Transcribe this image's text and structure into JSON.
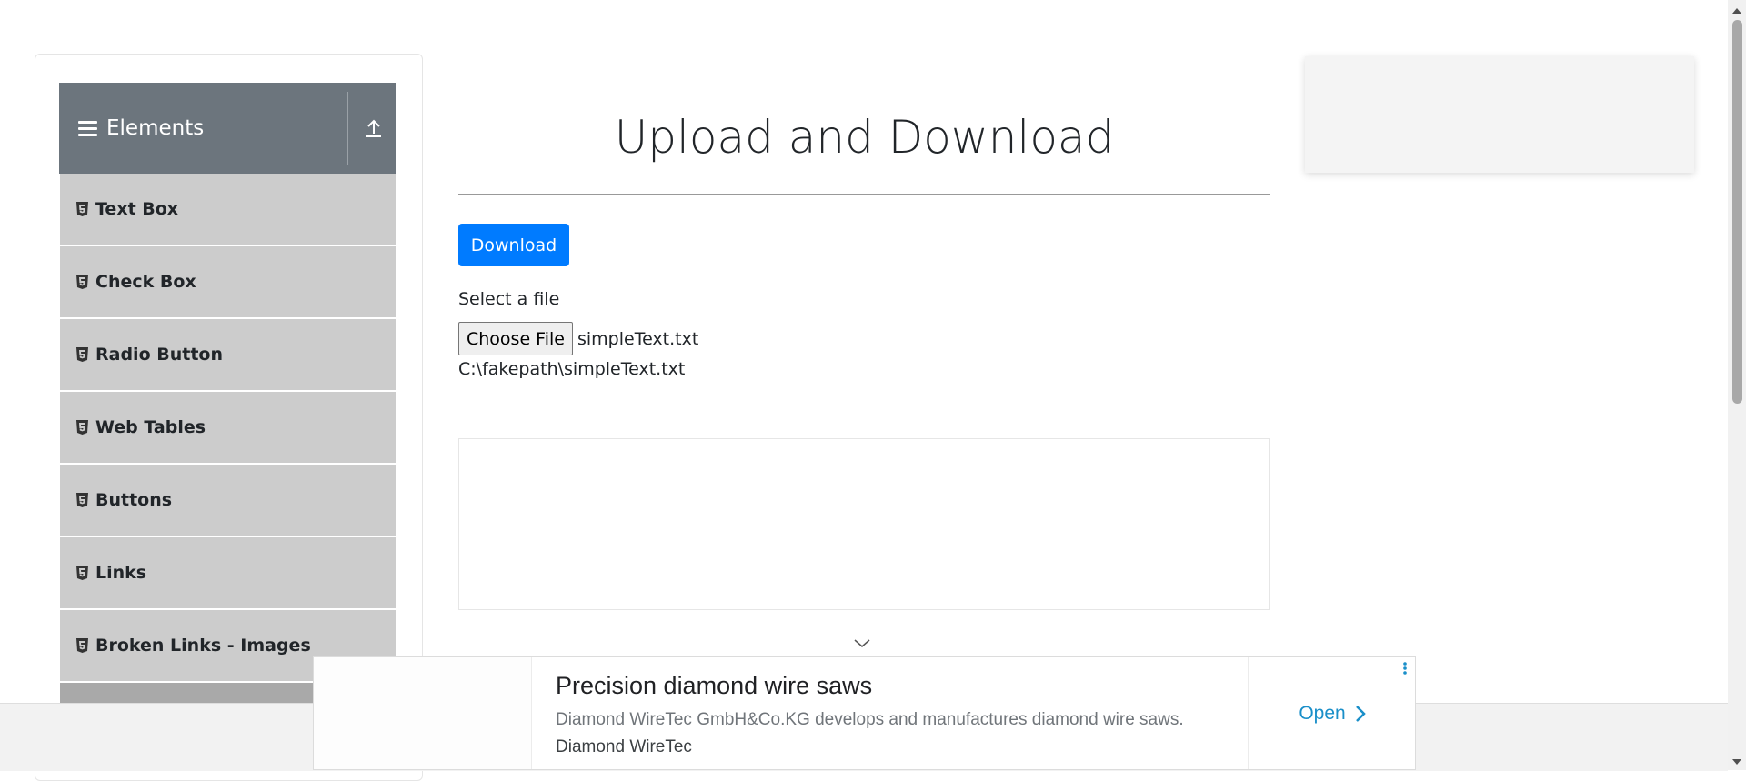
{
  "sidebar": {
    "group_title": "Elements",
    "items": [
      {
        "label": "Text Box"
      },
      {
        "label": "Check Box"
      },
      {
        "label": "Radio Button"
      },
      {
        "label": "Web Tables"
      },
      {
        "label": "Buttons"
      },
      {
        "label": "Links"
      },
      {
        "label": "Broken Links - Images"
      }
    ]
  },
  "main": {
    "title": "Upload and Download",
    "download_label": "Download",
    "select_file_label": "Select a file",
    "choose_file_label": "Choose File",
    "file_name": "simpleText.txt",
    "uploaded_path": "C:\\fakepath\\simpleText.txt"
  },
  "ad": {
    "title": "Precision diamond wire saws",
    "description": "Diamond WireTec GmbH&Co.KG develops and manufactures diamond wire saws.",
    "source": "Diamond WireTec",
    "open_label": "Open"
  },
  "colors": {
    "header_bg": "#6c757d",
    "menu_item_bg": "#cccccc",
    "primary_button": "#007bff",
    "ad_link": "#1a8fc9"
  }
}
